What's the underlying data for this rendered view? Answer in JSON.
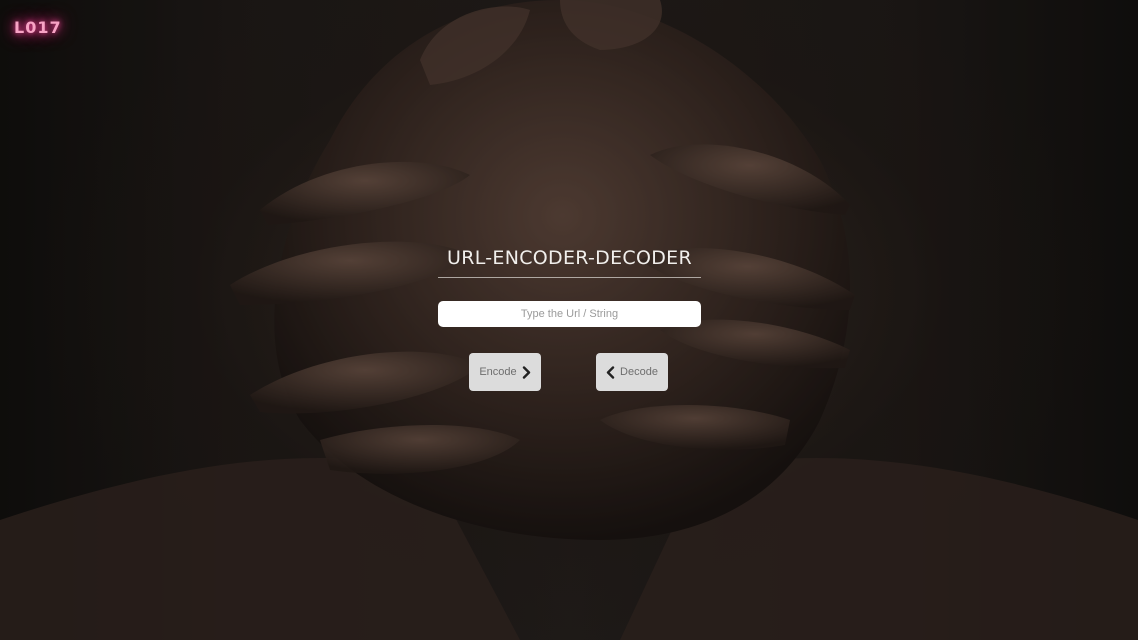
{
  "logo": {
    "text": "L017",
    "color": "#f06aa8"
  },
  "app": {
    "title": "URL-ENCODER-DECODER",
    "input": {
      "placeholder": "Type the Url / String",
      "value": ""
    },
    "encode_button": {
      "label": "Encode",
      "icon": "chevron-right-icon"
    },
    "decode_button": {
      "label": "Decode",
      "icon": "chevron-left-icon"
    }
  },
  "background": {
    "description_icon": "clasped-hands-photo"
  }
}
